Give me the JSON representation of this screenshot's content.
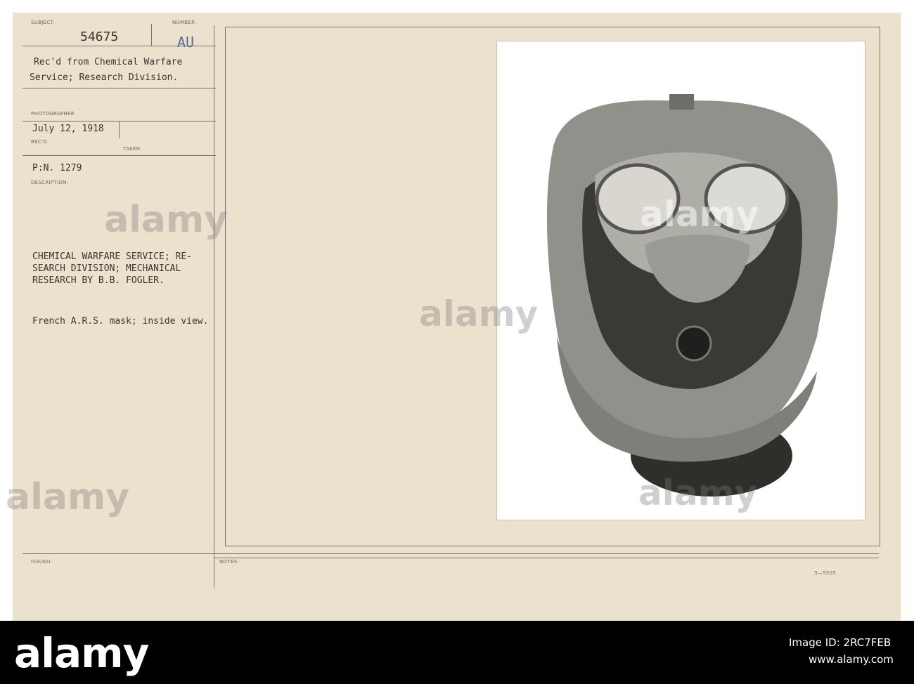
{
  "card": {
    "labels": {
      "subject": "SUBJECT:",
      "number": "NUMBER",
      "photographer": "PHOTOGRAPHER",
      "recd": "REC'D",
      "taken": "TAKEN",
      "description": "DESCRIPTION:",
      "issued": "ISSUED:",
      "notes": "NOTES:"
    },
    "subject_number": "54675",
    "number_code": "AU",
    "received_from": [
      "Rec'd from Chemical Warfare",
      "Service; Research Division."
    ],
    "date": "July 12, 1918",
    "pn": "P:N. 1279",
    "description_lines": [
      "CHEMICAL WARFARE SERVICE; RE-",
      "SEARCH DIVISION; MECHANICAL",
      "RESEARCH BY B.B. FOGLER."
    ],
    "caption": "French A.R.S. mask; inside view.",
    "form_code": "3—5505"
  },
  "photo": {
    "alt": "French A.R.S. gas mask, inside view"
  },
  "watermark": {
    "text": "alamy"
  },
  "footer": {
    "logo": "alamy",
    "image_id_label": "Image ID: 2RC7FEB",
    "url": "www.alamy.com"
  }
}
